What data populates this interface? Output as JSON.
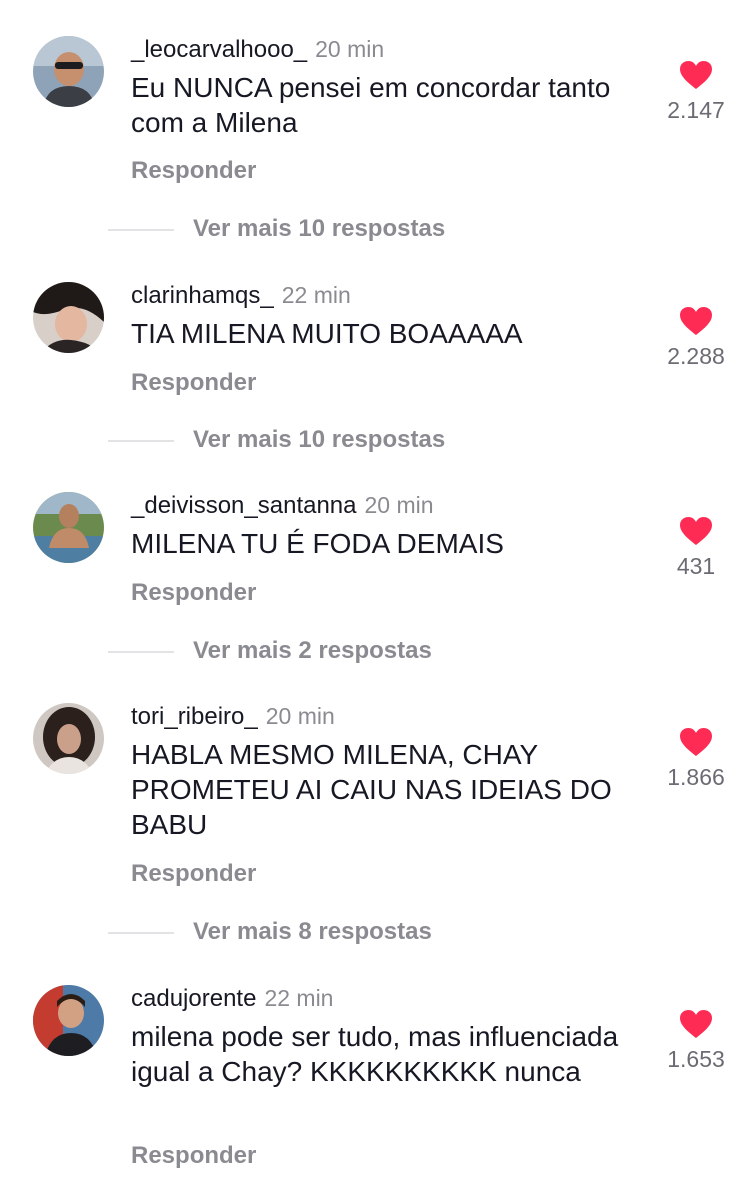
{
  "comments": [
    {
      "username": "_leocarvalhooo_",
      "time": "20 min",
      "text": "Eu NUNCA pensei em concordar tanto com a Milena",
      "likes": "2.147",
      "reply": "Responder",
      "more": "Ver mais 10 respostas"
    },
    {
      "username": "clarinhamqs_",
      "time": "22 min",
      "text": "TIA MILENA MUITO BOAAAAA",
      "likes": "2.288",
      "reply": "Responder",
      "more": "Ver mais 10 respostas"
    },
    {
      "username": "_deivisson_santanna",
      "time": "20 min",
      "text": "MILENA TU É FODA DEMAIS",
      "likes": "431",
      "reply": "Responder",
      "more": "Ver mais 2 respostas"
    },
    {
      "username": "tori_ribeiro_",
      "time": "20 min",
      "text": "HABLA MESMO MILENA, CHAY PROMETEU AI CAIU NAS IDEIAS DO BABU",
      "likes": "1.866",
      "reply": "Responder",
      "more": "Ver mais 8 respostas"
    },
    {
      "username": "cadujorente",
      "time": "22 min",
      "text": "milena pode ser tudo, mas influenciada igual a Chay? KKKKKKKKKK nunca",
      "likes": "1.653",
      "reply": "Responder"
    }
  ],
  "colors": {
    "heart": "#fe2c55",
    "primary_text": "#161823",
    "secondary_text": "#8a8b91"
  },
  "icons": {
    "like": "heart-icon"
  }
}
